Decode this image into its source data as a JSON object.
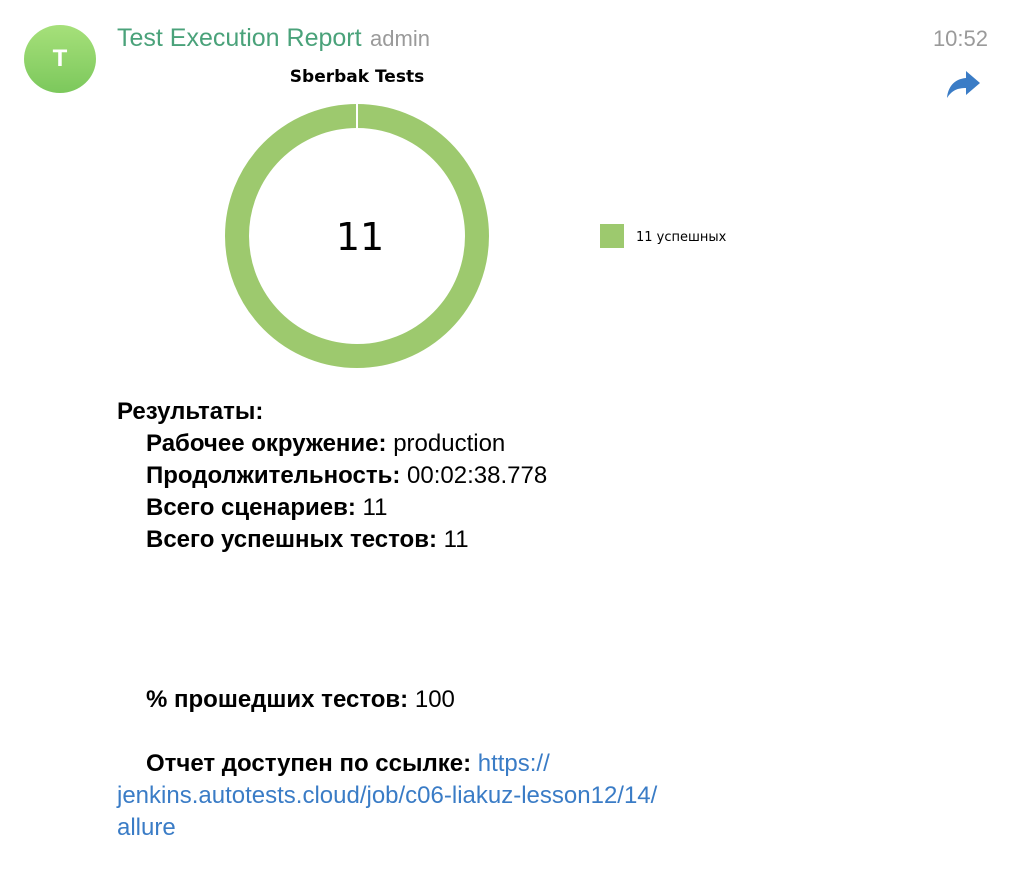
{
  "message": {
    "avatar_letter": "T",
    "sender": "Test Execution Report",
    "role": "admin",
    "time": "10:52",
    "share_icon": "share-arrow-icon"
  },
  "chart_data": {
    "type": "pie",
    "title": "Sberbak Tests",
    "center_label": "11",
    "slices": [
      {
        "label": "11 успешных",
        "value": 11,
        "color": "#9dc96e"
      }
    ],
    "legend_position": "right"
  },
  "results": {
    "heading": "Результаты:",
    "env_label": "Рабочее окружение:",
    "env_value": "production",
    "duration_label": "Продолжительность:",
    "duration_value": "00:02:38.778",
    "scenarios_label": "Всего сценариев:",
    "scenarios_value": "11",
    "passed_label": "Всего успешных тестов:",
    "passed_value": "11",
    "percent_label": "% прошедших тестов:",
    "percent_value": "100",
    "report_label": "Отчет доступен по ссылке:",
    "report_link": "https://jenkins.autotests.cloud/job/c06-liakuz-lesson12/14/allure"
  },
  "colors": {
    "sender": "#4aa27a",
    "link": "#3a7cc6",
    "muted": "#9a9a9a",
    "chart_green": "#9dc96e"
  }
}
